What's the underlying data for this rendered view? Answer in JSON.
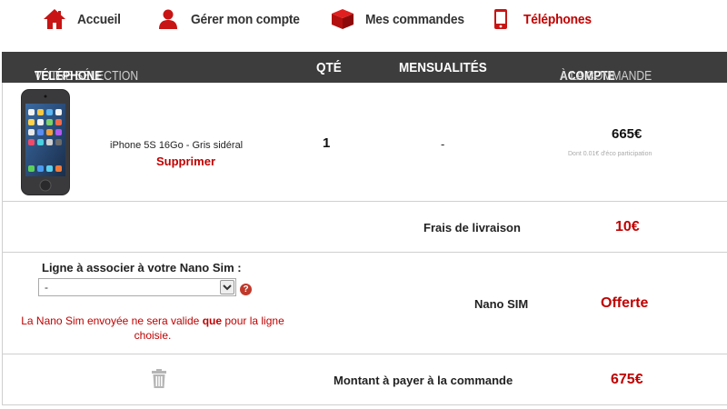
{
  "nav": {
    "home": "Accueil",
    "account": "Gérer mon compte",
    "orders": "Mes commandes",
    "phones": "Téléphones"
  },
  "header": {
    "selection_light": "VOTRE SÉLECTION",
    "selection_bold": "TÉLÉPHONE",
    "qty": "QTÉ",
    "monthly": "MENSUALITÉS",
    "deposit_bold": "ACOMPTE",
    "deposit_light": "À LA COMMANDE"
  },
  "product": {
    "name": "iPhone 5S 16Go - Gris sidéral",
    "delete_label": "Supprimer",
    "qty": "1",
    "monthly": "-",
    "price": "665€",
    "eco_note": "Dont 0.01€ d'éco participation"
  },
  "delivery": {
    "label": "Frais de livraison",
    "price": "10€"
  },
  "sim": {
    "line_label": "Ligne à associer à votre Nano Sim :",
    "select_value": "-",
    "warning_pre": "La Nano Sim envoyée ne sera valide ",
    "warning_bold": "que",
    "warning_post": " pour la ligne",
    "warning_line2": "choisie.",
    "label": "Nano SIM",
    "price": "Offerte"
  },
  "total": {
    "label": "Montant à payer à la commande",
    "price": "675€"
  },
  "colors": {
    "accent_red": "#c00000",
    "header_bg": "#3d3d3d"
  },
  "icons": [
    "home-icon",
    "user-icon",
    "box-icon",
    "phone-icon",
    "help-icon",
    "trash-icon",
    "chevron-down-icon"
  ]
}
